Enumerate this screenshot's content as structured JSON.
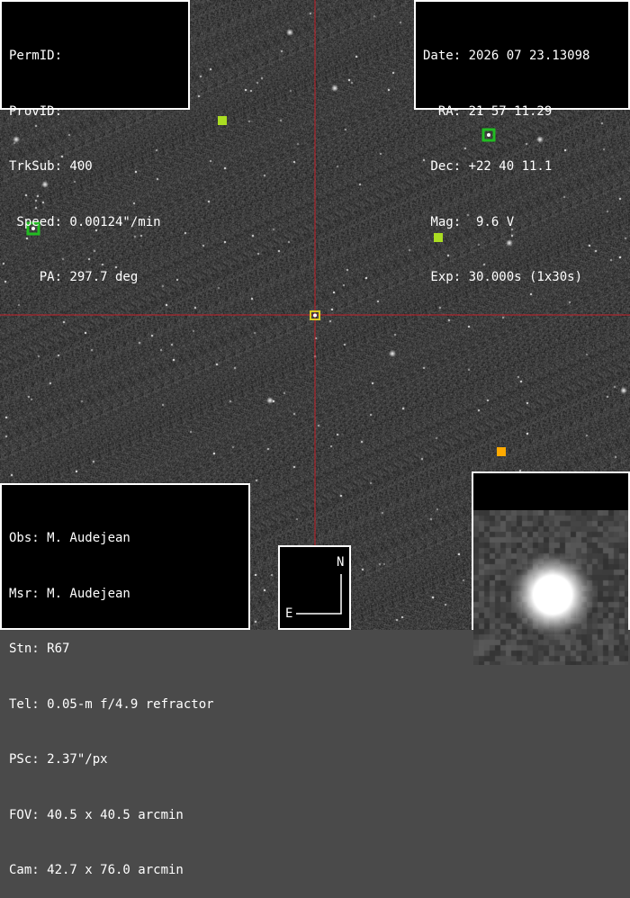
{
  "top_left_panel": {
    "lines": [
      "PermID:",
      "ProvID:",
      "TrkSub: 400",
      " Speed: 0.00124\"/min",
      "    PA: 297.7 deg"
    ]
  },
  "top_right_panel": {
    "lines": [
      "Date: 2026 07 23.13098",
      "  RA: 21 57 11.29",
      " Dec: +22 40 11.1",
      " Mag:  9.6 V",
      " Exp: 30.000s (1x30s)"
    ]
  },
  "bottom_left_panel": {
    "lines": [
      "Obs: M. Audejean",
      "Msr: M. Audejean",
      "Stn: R67",
      "Tel: 0.05-m f/4.9 refractor",
      "PSc: 2.37\"/px",
      "FOV: 40.5 x 40.5 arcmin",
      "Cam: 42.7 x 76.0 arcmin"
    ]
  },
  "compass": {
    "north_label": "N",
    "east_label": "E"
  },
  "colors": {
    "crosshair": "#c8202a",
    "marker_green": "#22bb22",
    "marker_lime": "#aadd22",
    "marker_orange": "#ffaa00",
    "target": "#ddcc22"
  }
}
